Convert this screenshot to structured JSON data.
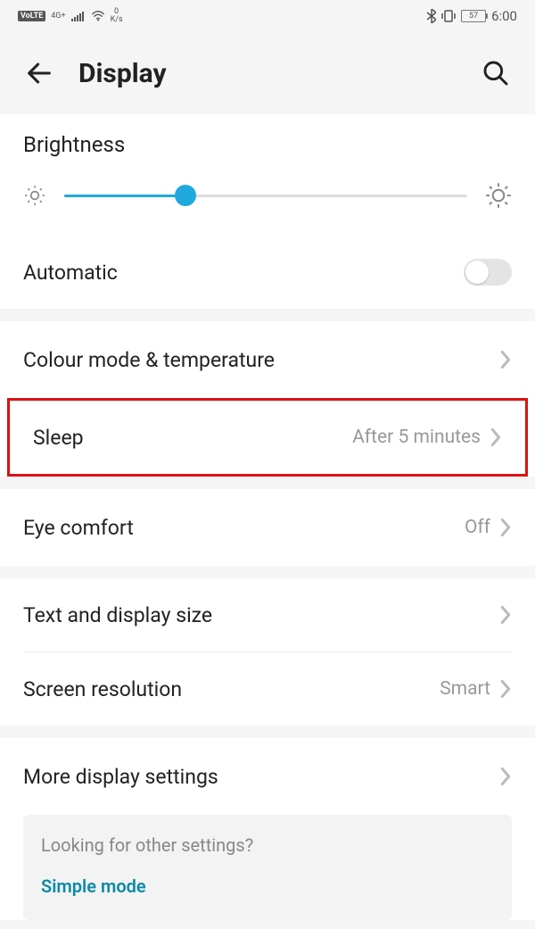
{
  "status": {
    "volte": "VoLTE",
    "net": "4G+",
    "speed_top": "0",
    "speed_bot": "K/s",
    "battery": "57",
    "time": "6:00"
  },
  "header": {
    "title": "Display"
  },
  "brightness": {
    "heading": "Brightness",
    "percent": 30,
    "automatic_label": "Automatic",
    "automatic_on": false
  },
  "rows": {
    "colour": {
      "label": "Colour mode & temperature"
    },
    "sleep": {
      "label": "Sleep",
      "value": "After 5 minutes"
    },
    "eye": {
      "label": "Eye comfort",
      "value": "Off"
    },
    "text": {
      "label": "Text and display size"
    },
    "res": {
      "label": "Screen resolution",
      "value": "Smart"
    },
    "more": {
      "label": "More display settings"
    }
  },
  "other": {
    "question": "Looking for other settings?",
    "link": "Simple mode"
  },
  "colors": {
    "accent": "#1fa9df"
  }
}
